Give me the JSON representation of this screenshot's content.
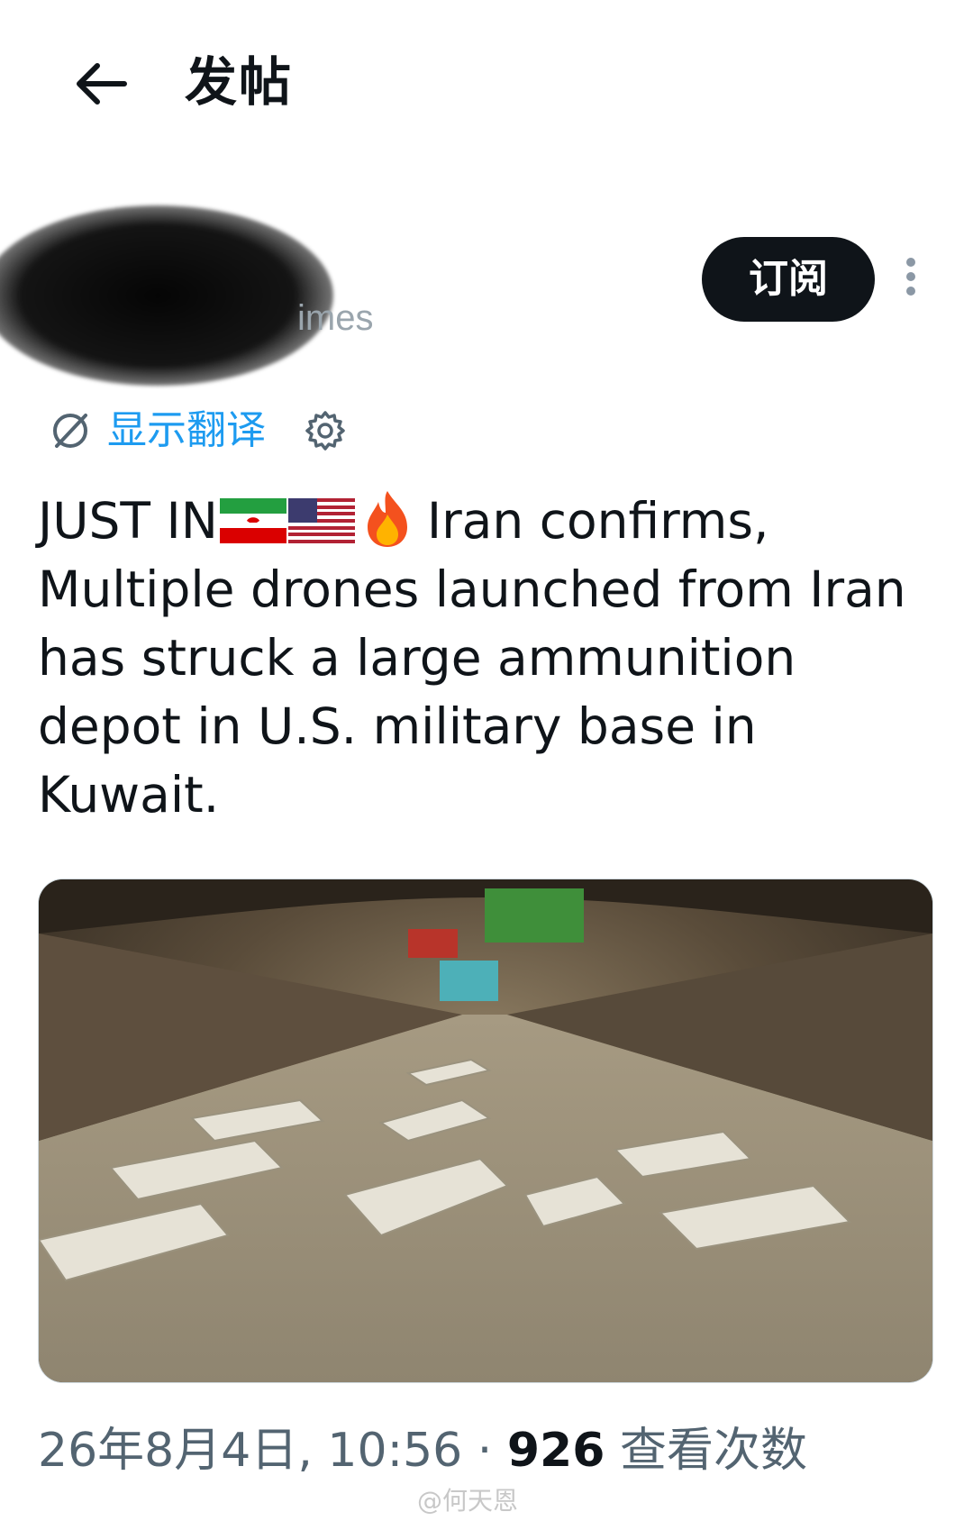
{
  "header": {
    "back_icon": "arrow-left-icon",
    "title": "发帖"
  },
  "author": {
    "handle_partial": "imes",
    "subscribe_label": "订阅",
    "more_icon": "more-vertical-icon"
  },
  "translate": {
    "icon": "translate-globe-icon",
    "label": "显示翻译",
    "settings_icon": "gear-icon"
  },
  "tweet": {
    "lead": "JUST IN",
    "text": "Iran confirms, Multiple drones launched from Iran has struck a large ammunition depot in U.S. military base in Kuwait."
  },
  "media": {
    "kind": "photo",
    "subject": "drones-in-tunnel"
  },
  "meta": {
    "date": "26年8月4日, 10:56",
    "separator": "·",
    "views_count": "926",
    "views_label": "查看次数"
  },
  "watermark": {
    "text": "@何天恩"
  },
  "colors": {
    "text_primary": "#0f1419",
    "text_secondary": "#536471",
    "link_blue": "#1d9bf0",
    "button_dark": "#0f1419"
  }
}
